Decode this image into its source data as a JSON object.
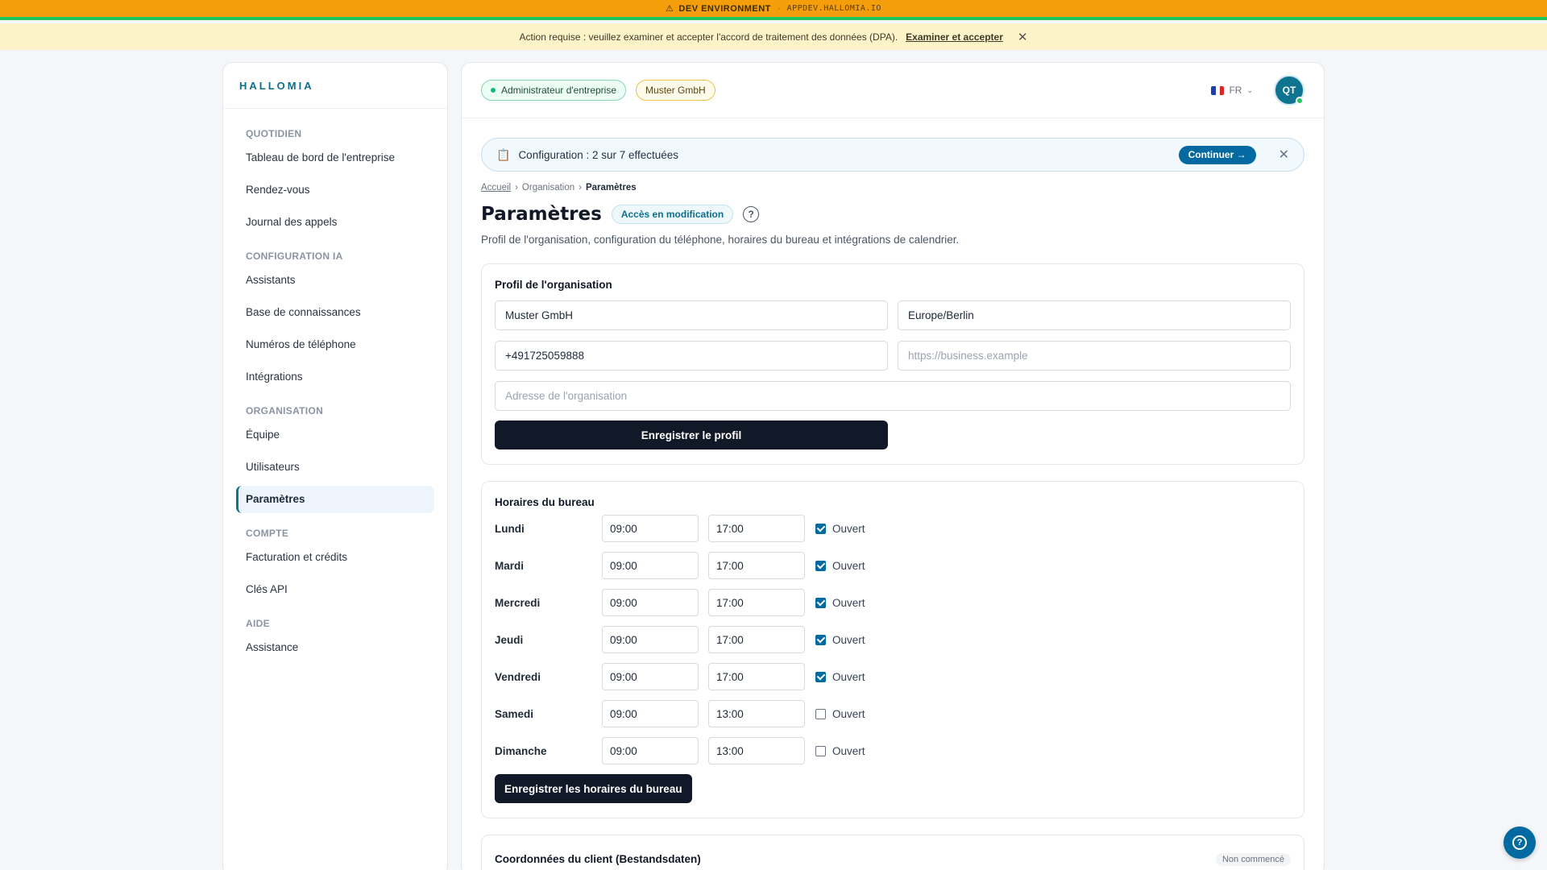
{
  "dev_banner": {
    "label": "DEV ENVIRONMENT",
    "separator": "·",
    "host": "APPDEV.HALLOMIA.IO"
  },
  "action_banner": {
    "message": "Action requise : veuillez examiner et accepter l'accord de traitement des données (DPA).",
    "link": "Examiner et accepter"
  },
  "sidebar": {
    "brand": "HALLOMIA",
    "sections": [
      {
        "title": "QUOTIDIEN",
        "items": [
          "Tableau de bord de l'entreprise",
          "Rendez-vous",
          "Journal des appels"
        ]
      },
      {
        "title": "CONFIGURATION IA",
        "items": [
          "Assistants",
          "Base de connaissances",
          "Numéros de téléphone",
          "Intégrations"
        ]
      },
      {
        "title": "ORGANISATION",
        "items": [
          "Équipe",
          "Utilisateurs",
          "Paramètres"
        ]
      },
      {
        "title": "COMPTE",
        "items": [
          "Facturation et crédits",
          "Clés API"
        ]
      },
      {
        "title": "AIDE",
        "items": [
          "Assistance"
        ]
      }
    ],
    "active_item": "Paramètres"
  },
  "topbar": {
    "role_chip": "Administrateur d'entreprise",
    "org_chip": "Muster GmbH",
    "language": "FR",
    "avatar_initials": "QT"
  },
  "setup": {
    "text": "Configuration : 2 sur 7 effectuées",
    "button": "Continuer →"
  },
  "breadcrumb": {
    "home": "Accueil",
    "sep": "›",
    "section": "Organisation",
    "current": "Paramètres"
  },
  "page": {
    "title": "Paramètres",
    "badge": "Accès en modification",
    "subtitle": "Profil de l'organisation, configuration du téléphone, horaires du bureau et intégrations de calendrier."
  },
  "profile": {
    "heading": "Profil de l'organisation",
    "name": "Muster GmbH",
    "timezone": "Europe/Berlin",
    "phone": "+491725059888",
    "website_placeholder": "https://business.example",
    "address_placeholder": "Adresse de l'organisation",
    "save_label": "Enregistrer le profil"
  },
  "hours": {
    "heading": "Horaires du bureau",
    "open_label": "Ouvert",
    "days": [
      {
        "day": "Lundi",
        "start": "09:00",
        "end": "17:00",
        "open": true
      },
      {
        "day": "Mardi",
        "start": "09:00",
        "end": "17:00",
        "open": true
      },
      {
        "day": "Mercredi",
        "start": "09:00",
        "end": "17:00",
        "open": true
      },
      {
        "day": "Jeudi",
        "start": "09:00",
        "end": "17:00",
        "open": true
      },
      {
        "day": "Vendredi",
        "start": "09:00",
        "end": "17:00",
        "open": true
      },
      {
        "day": "Samedi",
        "start": "09:00",
        "end": "13:00",
        "open": false
      },
      {
        "day": "Dimanche",
        "start": "09:00",
        "end": "13:00",
        "open": false
      }
    ],
    "save_label": "Enregistrer les horaires du bureau"
  },
  "customer_card": {
    "heading": "Coordonnées du client (Bestandsdaten)",
    "status": "Non commencé"
  },
  "colors": {
    "accent": "#0369a1",
    "brand": "#0e6f8c",
    "dev_banner": "#f59e0b",
    "action_banner": "#fdf3c9",
    "dark_button": "#111827"
  },
  "icons": {
    "warning": "warning-icon",
    "close": "close-icon",
    "clipboard": "clipboard-icon",
    "help": "help-circle-icon",
    "chevron": "chevron-down-icon"
  }
}
